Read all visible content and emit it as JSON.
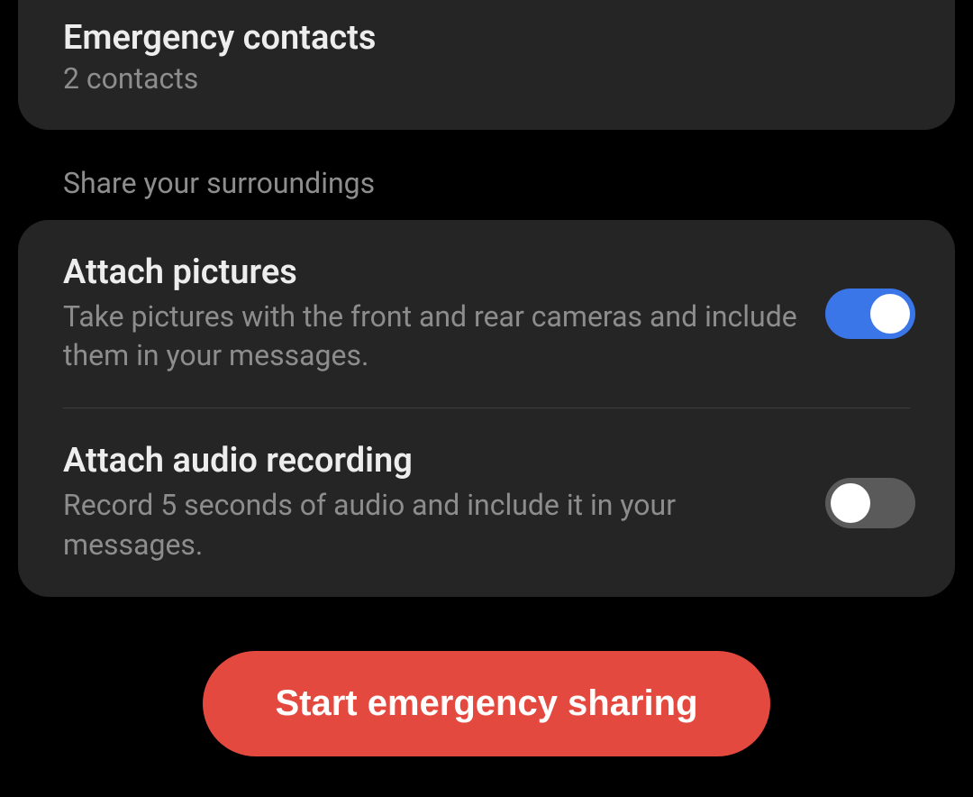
{
  "contacts": {
    "title": "Emergency contacts",
    "subtitle": "2 contacts"
  },
  "section_header": "Share your surroundings",
  "settings": {
    "pictures": {
      "title": "Attach pictures",
      "description": "Take pictures with the front and rear cameras and include them in your messages.",
      "enabled": true
    },
    "audio": {
      "title": "Attach audio recording",
      "description": "Record 5 seconds of audio and include it in your messages.",
      "enabled": false
    }
  },
  "action_button": "Start emergency sharing"
}
